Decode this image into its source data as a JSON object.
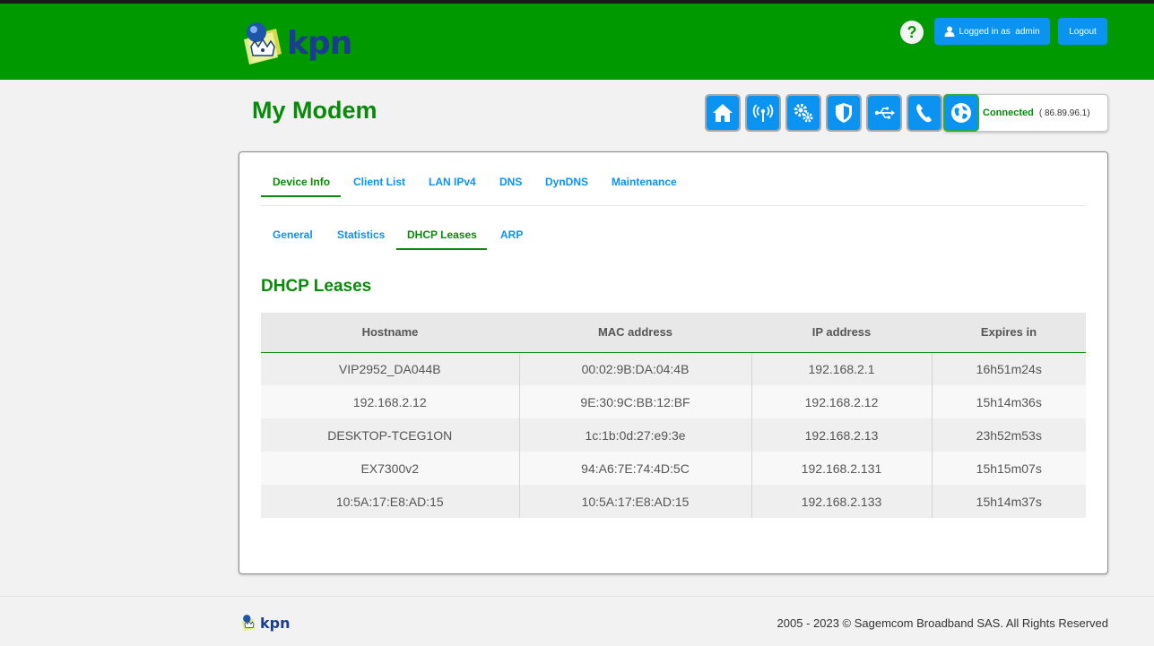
{
  "header": {
    "logo_text": "kpn",
    "help_label": "?",
    "login_prefix": "Logged in as",
    "login_user": "admin",
    "logout_label": "Logout"
  },
  "page": {
    "title": "My Modem"
  },
  "status": {
    "label": "Connected",
    "ip": "( 86.89.96.1)"
  },
  "icons": [
    "home-icon",
    "wifi-icon",
    "settings-icon",
    "shield-icon",
    "usb-icon",
    "phone-icon",
    "globe-icon"
  ],
  "tabs": [
    {
      "label": "Device Info",
      "active": true
    },
    {
      "label": "Client List"
    },
    {
      "label": "LAN IPv4"
    },
    {
      "label": "DNS"
    },
    {
      "label": "DynDNS"
    },
    {
      "label": "Maintenance"
    }
  ],
  "subtabs": [
    {
      "label": "General"
    },
    {
      "label": "Statistics"
    },
    {
      "label": "DHCP Leases",
      "active": true
    },
    {
      "label": "ARP"
    }
  ],
  "section": {
    "title": "DHCP Leases"
  },
  "table": {
    "headers": [
      "Hostname",
      "MAC address",
      "IP address",
      "Expires in"
    ],
    "rows": [
      [
        "VIP2952_DA044B",
        "00:02:9B:DA:04:4B",
        "192.168.2.1",
        "16h51m24s"
      ],
      [
        "192.168.2.12",
        "9E:30:9C:BB:12:BF",
        "192.168.2.12",
        "15h14m36s"
      ],
      [
        "DESKTOP-TCEG1ON",
        "1c:1b:0d:27:e9:3e",
        "192.168.2.13",
        "23h52m53s"
      ],
      [
        "EX7300v2",
        "94:A6:7E:74:4D:5C",
        "192.168.2.131",
        "15h15m07s"
      ],
      [
        "10:5A:17:E8:AD:15",
        "10:5A:17:E8:AD:15",
        "192.168.2.133",
        "15h14m37s"
      ]
    ]
  },
  "footer": {
    "logo_text": "kpn",
    "copyright": "2005 - 2023 © Sagemcom Broadband SAS. All Rights Reserved"
  },
  "colors": {
    "header_green": "#009900",
    "title_green": "#0a8a0a",
    "accent_blue": "#0a93f0"
  }
}
